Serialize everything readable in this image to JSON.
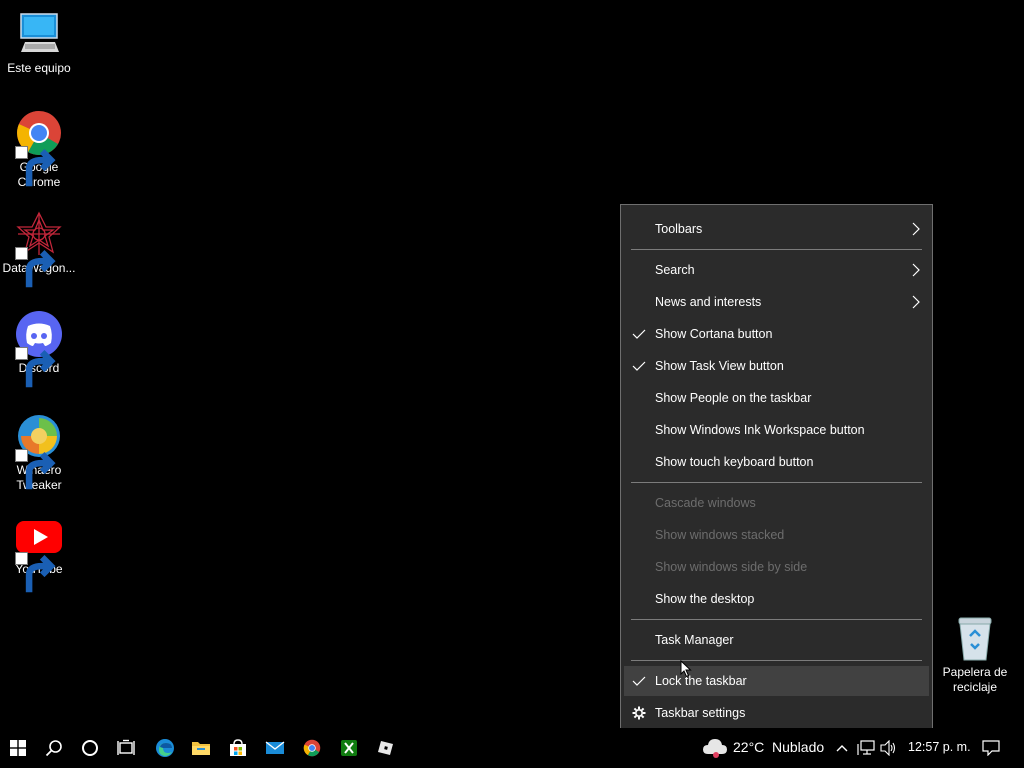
{
  "desktop": {
    "icons": [
      {
        "label": "Este equipo",
        "icon": "computer-icon"
      },
      {
        "label": "Google\nChrome",
        "icon": "chrome-icon"
      },
      {
        "label": "DataWagon...",
        "icon": "datawagon-icon"
      },
      {
        "label": "Discord",
        "icon": "discord-icon"
      },
      {
        "label": "Winaero\nTweaker",
        "icon": "winaero-icon"
      },
      {
        "label": "YouTube",
        "icon": "youtube-icon"
      },
      {
        "label": "Papelera de\nreciclaje",
        "icon": "recycle-bin-icon"
      }
    ]
  },
  "menu": {
    "items": [
      {
        "label": "Toolbars",
        "submenu": true
      },
      {
        "label": "Search",
        "submenu": true
      },
      {
        "label": "News and interests",
        "submenu": true
      },
      {
        "label": "Show Cortana button",
        "checked": true
      },
      {
        "label": "Show Task View button",
        "checked": true
      },
      {
        "label": "Show People on the taskbar"
      },
      {
        "label": "Show Windows Ink Workspace button"
      },
      {
        "label": "Show touch keyboard button"
      },
      {
        "label": "Cascade windows",
        "disabled": true
      },
      {
        "label": "Show windows stacked",
        "disabled": true
      },
      {
        "label": "Show windows side by side",
        "disabled": true
      },
      {
        "label": "Show the desktop"
      },
      {
        "label": "Task Manager"
      },
      {
        "label": "Lock the taskbar",
        "checked": true,
        "highlighted": true
      },
      {
        "label": "Taskbar settings",
        "icon": "gear-icon"
      }
    ]
  },
  "taskbar": {
    "pinned": [
      "start-icon",
      "search-icon",
      "cortana-icon",
      "task-view-icon",
      "edge-icon",
      "file-explorer-icon",
      "store-icon",
      "mail-icon",
      "chrome-icon",
      "xbox-icon",
      "roblox-icon"
    ],
    "weather": {
      "temp": "22°C",
      "condition": "Nublado"
    },
    "clock": "12:57 p. m."
  },
  "colors": {
    "menu_bg": "#2b2b2b",
    "menu_hover": "#414141",
    "disabled_text": "#6d6d6d"
  }
}
